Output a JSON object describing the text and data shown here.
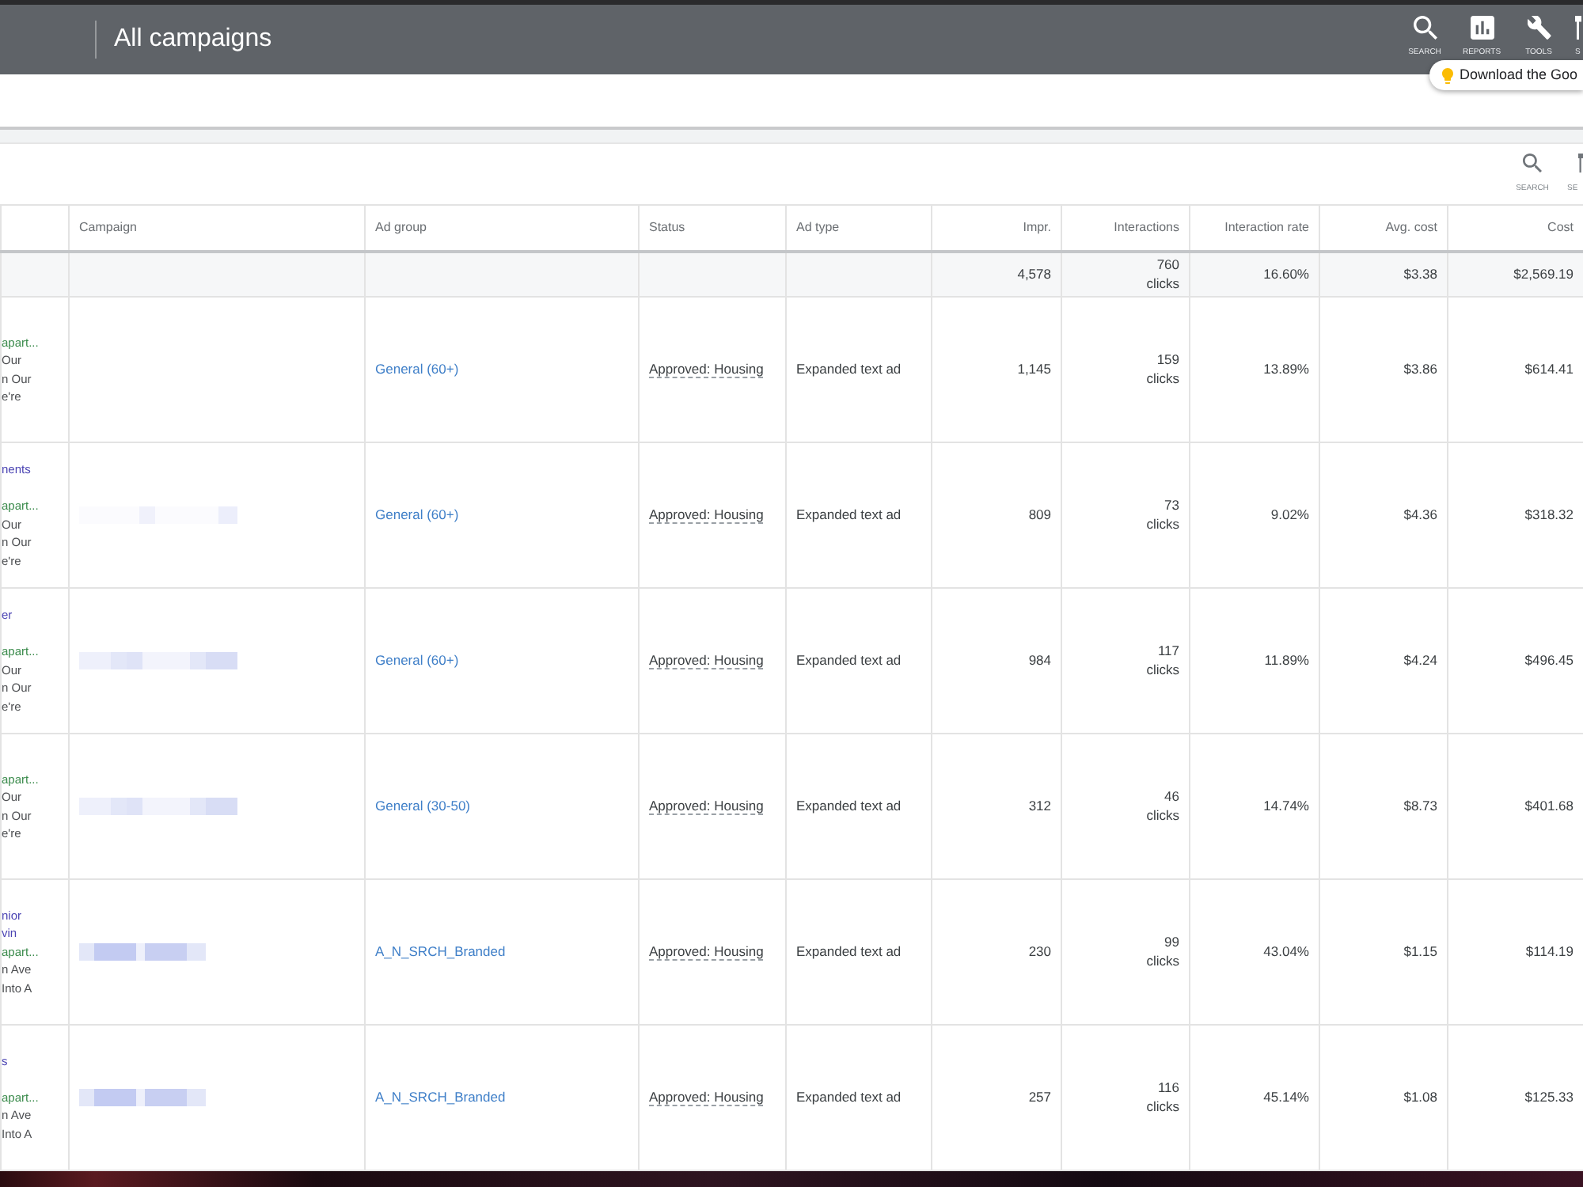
{
  "header": {
    "title": "All campaigns",
    "actions": [
      {
        "kind": "search",
        "label": "SEARCH"
      },
      {
        "kind": "reports",
        "label": "REPORTS"
      },
      {
        "kind": "tools",
        "label": "TOOLS"
      },
      {
        "kind": "cut",
        "label": "S"
      }
    ]
  },
  "tooltip": {
    "text": "Download the Goo"
  },
  "toolbar": {
    "actions": [
      {
        "kind": "search",
        "label": "SEARCH"
      },
      {
        "kind": "cut",
        "label": "SE"
      }
    ]
  },
  "table": {
    "columns": [
      {
        "label": "Campaign",
        "kind": "text"
      },
      {
        "label": "Ad group",
        "kind": "text"
      },
      {
        "label": "Status",
        "kind": "text"
      },
      {
        "label": "Ad type",
        "kind": "text"
      },
      {
        "label": "Impr.",
        "kind": "number"
      },
      {
        "label": "Interactions",
        "kind": "number"
      },
      {
        "label": "Interaction rate",
        "kind": "number"
      },
      {
        "label": "Avg. cost",
        "kind": "number"
      },
      {
        "label": "Cost",
        "kind": "number"
      }
    ],
    "totals": {
      "impr": "4,578",
      "interactions": "760",
      "interactions_unit": "clicks",
      "interaction_rate": "16.60%",
      "avg_cost": "$3.38",
      "cost": "$2,569.19"
    },
    "rows": [
      {
        "ad": {
          "url": "apart...",
          "description": [
            "Our",
            "n Our",
            "e're"
          ]
        },
        "ad_group": "General (60+)",
        "status": "Approved: Housing",
        "ad_type": "Expanded text ad",
        "impr": "1,145",
        "interactions": "159",
        "interactions_unit": "clicks",
        "interaction_rate": "13.89%",
        "avg_cost": "$3.86",
        "cost": "$614.41"
      },
      {
        "ad": {
          "headline": [
            "nents"
          ],
          "url": "apart...",
          "description": [
            "Our",
            "n Our",
            "e're"
          ]
        },
        "campaign": {
          "kind": "faint"
        },
        "ad_group": "General (60+)",
        "status": "Approved: Housing",
        "ad_type": "Expanded text ad",
        "impr": "809",
        "interactions": "73",
        "interactions_unit": "clicks",
        "interaction_rate": "9.02%",
        "avg_cost": "$4.36",
        "cost": "$318.32"
      },
      {
        "ad": {
          "headline": [
            "er"
          ],
          "url": "apart...",
          "description": [
            "Our",
            "n Our",
            "e're"
          ]
        },
        "campaign": {
          "kind": "light"
        },
        "ad_group": "General (60+)",
        "status": "Approved: Housing",
        "ad_type": "Expanded text ad",
        "impr": "984",
        "interactions": "117",
        "interactions_unit": "clicks",
        "interaction_rate": "11.89%",
        "avg_cost": "$4.24",
        "cost": "$496.45"
      },
      {
        "ad": {
          "url": "apart...",
          "description": [
            "Our",
            "n Our",
            "e're"
          ]
        },
        "campaign": {
          "kind": "light"
        },
        "ad_group": "General (30-50)",
        "status": "Approved: Housing",
        "ad_type": "Expanded text ad",
        "impr": "312",
        "interactions": "46",
        "interactions_unit": "clicks",
        "interaction_rate": "14.74%",
        "avg_cost": "$8.73",
        "cost": "$401.68"
      },
      {
        "ad": {
          "headline": [
            "nior",
            "vin"
          ],
          "url": "apart...",
          "description": [
            "n Ave",
            "Into A"
          ]
        },
        "campaign": {
          "kind": "strong"
        },
        "ad_group": "A_N_SRCH_Branded",
        "status": "Approved: Housing",
        "ad_type": "Expanded text ad",
        "impr": "230",
        "interactions": "99",
        "interactions_unit": "clicks",
        "interaction_rate": "43.04%",
        "avg_cost": "$1.15",
        "cost": "$114.19"
      },
      {
        "ad": {
          "headline": [
            "s"
          ],
          "url": "apart...",
          "description": [
            "n Ave",
            "Into A"
          ]
        },
        "campaign": {
          "kind": "strong"
        },
        "ad_group": "A_N_SRCH_Branded",
        "status": "Approved: Housing",
        "ad_type": "Expanded text ad",
        "impr": "257",
        "interactions": "116",
        "interactions_unit": "clicks",
        "interaction_rate": "45.14%",
        "avg_cost": "$1.08",
        "cost": "$125.33"
      }
    ]
  }
}
